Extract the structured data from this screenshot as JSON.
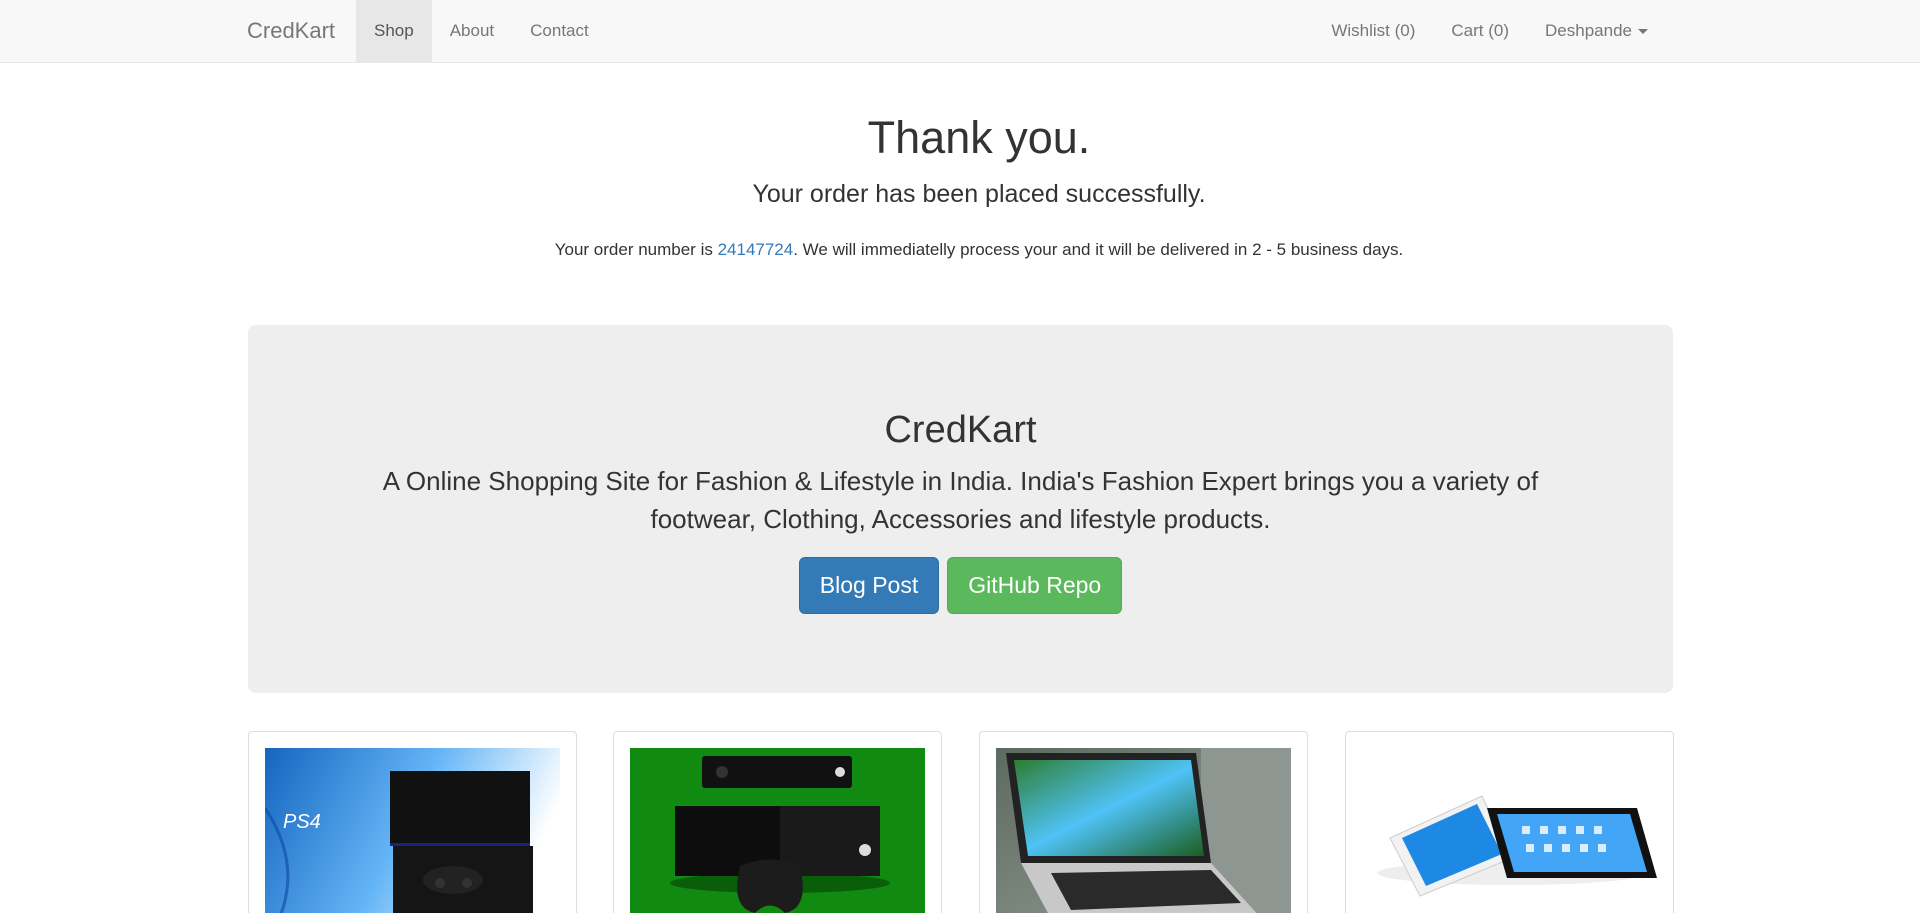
{
  "navbar": {
    "brand": "CredKart",
    "left_links": [
      "Shop",
      "About",
      "Contact"
    ],
    "active": "Shop",
    "wishlist": "Wishlist (0)",
    "cart": "Cart (0)",
    "user": "Deshpande"
  },
  "confirmation": {
    "title": "Thank you.",
    "subtitle": "Your order has been placed successfully.",
    "order_prefix": "Your order number is ",
    "order_number": "24147724",
    "order_suffix": ". We will immediatelly process your and it will be delivered in 2 - 5 business days."
  },
  "jumbotron": {
    "title": "CredKart",
    "text": "A Online Shopping Site for Fashion & Lifestyle in India. India's Fashion Expert brings you a variety of footwear, Clothing, Accessories and lifestyle products.",
    "blog_button": "Blog Post",
    "github_button": "GitHub Repo"
  },
  "products": [
    {
      "image": "ps4-console-image",
      "logo_text": "PS4"
    },
    {
      "image": "xbox-one-console-image"
    },
    {
      "image": "macbook-laptop-image"
    },
    {
      "image": "ipad-tablets-image"
    }
  ],
  "colors": {
    "primary": "#337ab7",
    "success": "#5cb85c",
    "navbar_bg": "#f8f8f8",
    "jumbotron_bg": "#eeeeee",
    "link": "#337ab7"
  }
}
